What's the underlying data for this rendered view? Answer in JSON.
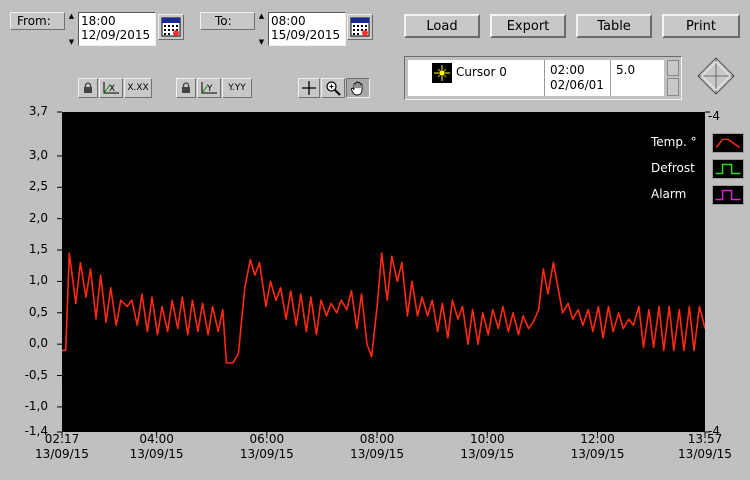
{
  "range": {
    "from_label": "From:",
    "from_time": "18:00",
    "from_date": "12/09/2015",
    "to_label": "To:",
    "to_time": "08:00",
    "to_date": "15/09/2015"
  },
  "toolbar": {
    "load_label": "Load",
    "export_label": "Export",
    "table_label": "Table",
    "print_label": "Print"
  },
  "scale_tools": {
    "x_format": "X.XX",
    "y_format": "Y.YY"
  },
  "cursor": {
    "name": "Cursor 0",
    "time": "02:00",
    "date": "02/06/01",
    "value": "5.0"
  },
  "chart_data": {
    "type": "line",
    "ylim": [
      -1.4,
      3.7
    ],
    "y2_label_top": "-4",
    "y2_label_bottom": "-4",
    "yticks": [
      {
        "v": 3.7,
        "label": "3,7"
      },
      {
        "v": 3.0,
        "label": "3,0"
      },
      {
        "v": 2.5,
        "label": "2,5"
      },
      {
        "v": 2.0,
        "label": "2,0"
      },
      {
        "v": 1.5,
        "label": "1,5"
      },
      {
        "v": 1.0,
        "label": "1,0"
      },
      {
        "v": 0.5,
        "label": "0,5"
      },
      {
        "v": 0.0,
        "label": "0,0"
      },
      {
        "v": -0.5,
        "label": "-0,5"
      },
      {
        "v": -1.0,
        "label": "-1,0"
      },
      {
        "v": -1.4,
        "label": "-1,4"
      }
    ],
    "xlim": [
      "02:17",
      "13:57"
    ],
    "xticks": [
      {
        "t": "02:17",
        "time": "02:17",
        "date": "13/09/15"
      },
      {
        "t": "04:00",
        "time": "04:00",
        "date": "13/09/15"
      },
      {
        "t": "06:00",
        "time": "06:00",
        "date": "13/09/15"
      },
      {
        "t": "08:00",
        "time": "08:00",
        "date": "13/09/15"
      },
      {
        "t": "10:00",
        "time": "10:00",
        "date": "13/09/15"
      },
      {
        "t": "12:00",
        "time": "12:00",
        "date": "13/09/15"
      },
      {
        "t": "13:57",
        "time": "13:57",
        "date": "13/09/15"
      }
    ],
    "legend_placement": "top-right",
    "series": [
      {
        "name": "Temp. °",
        "color": "#ff2a10",
        "points": [
          [
            "02:17",
            -0.1
          ],
          [
            "02:21",
            -0.1
          ],
          [
            "02:25",
            1.45
          ],
          [
            "02:32",
            0.65
          ],
          [
            "02:37",
            1.3
          ],
          [
            "02:43",
            0.75
          ],
          [
            "02:48",
            1.2
          ],
          [
            "02:54",
            0.4
          ],
          [
            "02:59",
            1.1
          ],
          [
            "03:05",
            0.35
          ],
          [
            "03:10",
            0.9
          ],
          [
            "03:16",
            0.3
          ],
          [
            "03:21",
            0.7
          ],
          [
            "03:28",
            0.6
          ],
          [
            "03:33",
            0.7
          ],
          [
            "03:39",
            0.3
          ],
          [
            "03:44",
            0.8
          ],
          [
            "03:50",
            0.2
          ],
          [
            "03:55",
            0.75
          ],
          [
            "04:01",
            0.15
          ],
          [
            "04:06",
            0.6
          ],
          [
            "04:12",
            0.2
          ],
          [
            "04:17",
            0.7
          ],
          [
            "04:23",
            0.25
          ],
          [
            "04:28",
            0.75
          ],
          [
            "04:34",
            0.15
          ],
          [
            "04:39",
            0.7
          ],
          [
            "04:45",
            0.2
          ],
          [
            "04:50",
            0.65
          ],
          [
            "04:56",
            0.15
          ],
          [
            "05:01",
            0.6
          ],
          [
            "05:07",
            0.2
          ],
          [
            "05:12",
            0.55
          ],
          [
            "05:16",
            -0.3
          ],
          [
            "05:23",
            -0.3
          ],
          [
            "05:29",
            -0.15
          ],
          [
            "05:36",
            0.9
          ],
          [
            "05:42",
            1.35
          ],
          [
            "05:47",
            1.1
          ],
          [
            "05:52",
            1.3
          ],
          [
            "05:59",
            0.6
          ],
          [
            "06:04",
            1.0
          ],
          [
            "06:10",
            0.7
          ],
          [
            "06:15",
            0.9
          ],
          [
            "06:21",
            0.4
          ],
          [
            "06:26",
            0.85
          ],
          [
            "06:32",
            0.3
          ],
          [
            "06:37",
            0.8
          ],
          [
            "06:43",
            0.2
          ],
          [
            "06:48",
            0.75
          ],
          [
            "06:54",
            0.15
          ],
          [
            "06:59",
            0.7
          ],
          [
            "07:05",
            0.45
          ],
          [
            "07:10",
            0.65
          ],
          [
            "07:16",
            0.5
          ],
          [
            "07:21",
            0.7
          ],
          [
            "07:27",
            0.55
          ],
          [
            "07:32",
            0.85
          ],
          [
            "07:38",
            0.25
          ],
          [
            "07:43",
            0.8
          ],
          [
            "07:49",
            0.0
          ],
          [
            "07:54",
            -0.2
          ],
          [
            "08:00",
            0.6
          ],
          [
            "08:05",
            1.45
          ],
          [
            "08:11",
            0.7
          ],
          [
            "08:16",
            1.4
          ],
          [
            "08:22",
            1.0
          ],
          [
            "08:27",
            1.3
          ],
          [
            "08:33",
            0.45
          ],
          [
            "08:38",
            1.0
          ],
          [
            "08:44",
            0.45
          ],
          [
            "08:49",
            0.75
          ],
          [
            "08:55",
            0.45
          ],
          [
            "09:00",
            0.7
          ],
          [
            "09:06",
            0.2
          ],
          [
            "09:11",
            0.65
          ],
          [
            "09:17",
            0.1
          ],
          [
            "09:22",
            0.7
          ],
          [
            "09:28",
            0.4
          ],
          [
            "09:33",
            0.6
          ],
          [
            "09:39",
            0.0
          ],
          [
            "09:44",
            0.55
          ],
          [
            "09:50",
            0.0
          ],
          [
            "09:55",
            0.5
          ],
          [
            "10:01",
            0.15
          ],
          [
            "10:06",
            0.55
          ],
          [
            "10:12",
            0.25
          ],
          [
            "10:17",
            0.6
          ],
          [
            "10:23",
            0.2
          ],
          [
            "10:28",
            0.5
          ],
          [
            "10:34",
            0.15
          ],
          [
            "10:39",
            0.45
          ],
          [
            "10:45",
            0.25
          ],
          [
            "10:50",
            0.35
          ],
          [
            "10:56",
            0.55
          ],
          [
            "11:01",
            1.2
          ],
          [
            "11:06",
            0.8
          ],
          [
            "11:12",
            1.3
          ],
          [
            "11:17",
            0.9
          ],
          [
            "11:22",
            0.5
          ],
          [
            "11:28",
            0.65
          ],
          [
            "11:33",
            0.4
          ],
          [
            "11:39",
            0.55
          ],
          [
            "11:44",
            0.3
          ],
          [
            "11:50",
            0.55
          ],
          [
            "11:55",
            0.2
          ],
          [
            "12:01",
            0.6
          ],
          [
            "12:06",
            0.1
          ],
          [
            "12:12",
            0.6
          ],
          [
            "12:17",
            0.2
          ],
          [
            "12:23",
            0.5
          ],
          [
            "12:28",
            0.25
          ],
          [
            "12:34",
            0.4
          ],
          [
            "12:39",
            0.3
          ],
          [
            "12:45",
            0.6
          ],
          [
            "12:50",
            -0.05
          ],
          [
            "12:56",
            0.55
          ],
          [
            "13:01",
            -0.05
          ],
          [
            "13:07",
            0.6
          ],
          [
            "13:12",
            -0.1
          ],
          [
            "13:18",
            0.6
          ],
          [
            "13:23",
            -0.1
          ],
          [
            "13:29",
            0.55
          ],
          [
            "13:34",
            -0.1
          ],
          [
            "13:40",
            0.6
          ],
          [
            "13:45",
            -0.1
          ],
          [
            "13:51",
            0.6
          ],
          [
            "13:57",
            0.25
          ]
        ]
      },
      {
        "name": "Defrost",
        "color": "#22dd22",
        "points": []
      },
      {
        "name": "Alarm",
        "color": "#dd22dd",
        "points": []
      }
    ]
  }
}
